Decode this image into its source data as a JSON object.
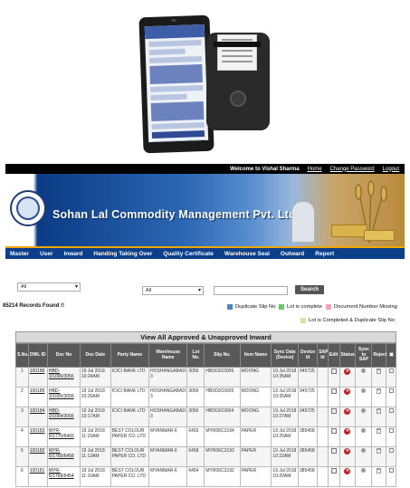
{
  "colors": {
    "header_bg": "#000000",
    "banner_blue": "#0b3f8a",
    "nav_accent": "#f0a800",
    "table_header": "#595959",
    "duplicate_slip": "#4f86c6",
    "lot_complete": "#6ec86e",
    "doc_missing": "#f2a5b0",
    "lot_complete_dup": "#cfe8a0",
    "status_red": "#c21f1f"
  },
  "topbar": {
    "welcome": "Welcome to Vishal Sharma",
    "home": "Home",
    "change_password": "Change Password",
    "logout": "Logout"
  },
  "banner": {
    "title": "Sohan Lal Commodity Management Pvt. Ltd."
  },
  "nav": {
    "items": [
      "Master",
      "User",
      "Inward",
      "Handing Taking Over",
      "Quality Certificate",
      "Warehouse Seal",
      "Outward",
      "Report"
    ]
  },
  "filters": {
    "select1": "All",
    "select2": "All",
    "search_button": "Search"
  },
  "records_found": "85214 Records Found !!",
  "legend": {
    "duplicate_slip": "Duplicate Slip No",
    "lot_complete": "Lot is complete",
    "doc_missing": "Document Number Missing",
    "lot_complete_dup": "Lot is Completed & Duplicate Slip No"
  },
  "table": {
    "caption": "View All Approved & Unapproved Inward",
    "headers": [
      "S.No.",
      "DWL ID",
      "Doc No",
      "Doc Date",
      "Party Name",
      "Warehouse Name",
      "Lot No.",
      "Slip No.",
      "Item Name",
      "Sync Date (Device)",
      "Device Id",
      "SAP Id",
      "Edit",
      "Status",
      "Sync to SAP",
      "Reject",
      ""
    ],
    "rows": [
      [
        "1",
        "100186",
        "HBD-3/1006/3056",
        "19 Jul 2018 10:24AM",
        "ICICI BANK LTD",
        "HOSHANGABAD-3",
        "3056",
        "HBD03C0006",
        "MOONG",
        "19 Jul 2018 10:35AM",
        "945725"
      ],
      [
        "2",
        "100185",
        "HBD-3/1005/3056",
        "19 Jul 2018 10:20AM",
        "ICICI BANK LTD",
        "HOSHANGABAD-3",
        "3056",
        "HBD03C0005",
        "MOONG",
        "19 Jul 2018 10:35AM",
        "945725"
      ],
      [
        "3",
        "100184",
        "HBD-3/1004/3056",
        "19 Jul 2018 10:17AM",
        "ICICI BANK LTD",
        "HOSHANGABAD-3",
        "3056",
        "HBD03C0004",
        "MOONG",
        "19 Jul 2018 10:27AM",
        "945725"
      ],
      [
        "4",
        "100183",
        "MYR-6/1770/6493",
        "19 Jul 2018 11:15AM",
        "BEST COLOUR PAPER CO. LTD",
        "MYANMAR-6",
        "6493",
        "MYR06C3194",
        "PAPER",
        "19 Jul 2018 10:25AM",
        "385458"
      ],
      [
        "5",
        "100182",
        "MYR-6/1769/6458",
        "19 Jul 2018 11:13AM",
        "BEST COLOUR PAPER CO. LTD",
        "MYANMAR-6",
        "6458",
        "MYR06C3193",
        "PAPER",
        "19 Jul 2018 10:22AM",
        "385458"
      ],
      [
        "6",
        "100181",
        "MYR-6/1768/6454",
        "19 Jul 2018 11:10AM",
        "BEST COLOUR PAPER CO. LTD",
        "MYANMAR-6",
        "6454",
        "MYR06C3192",
        "PAPER",
        "19 Jul 2018 10:20AM",
        "385458"
      ]
    ]
  }
}
